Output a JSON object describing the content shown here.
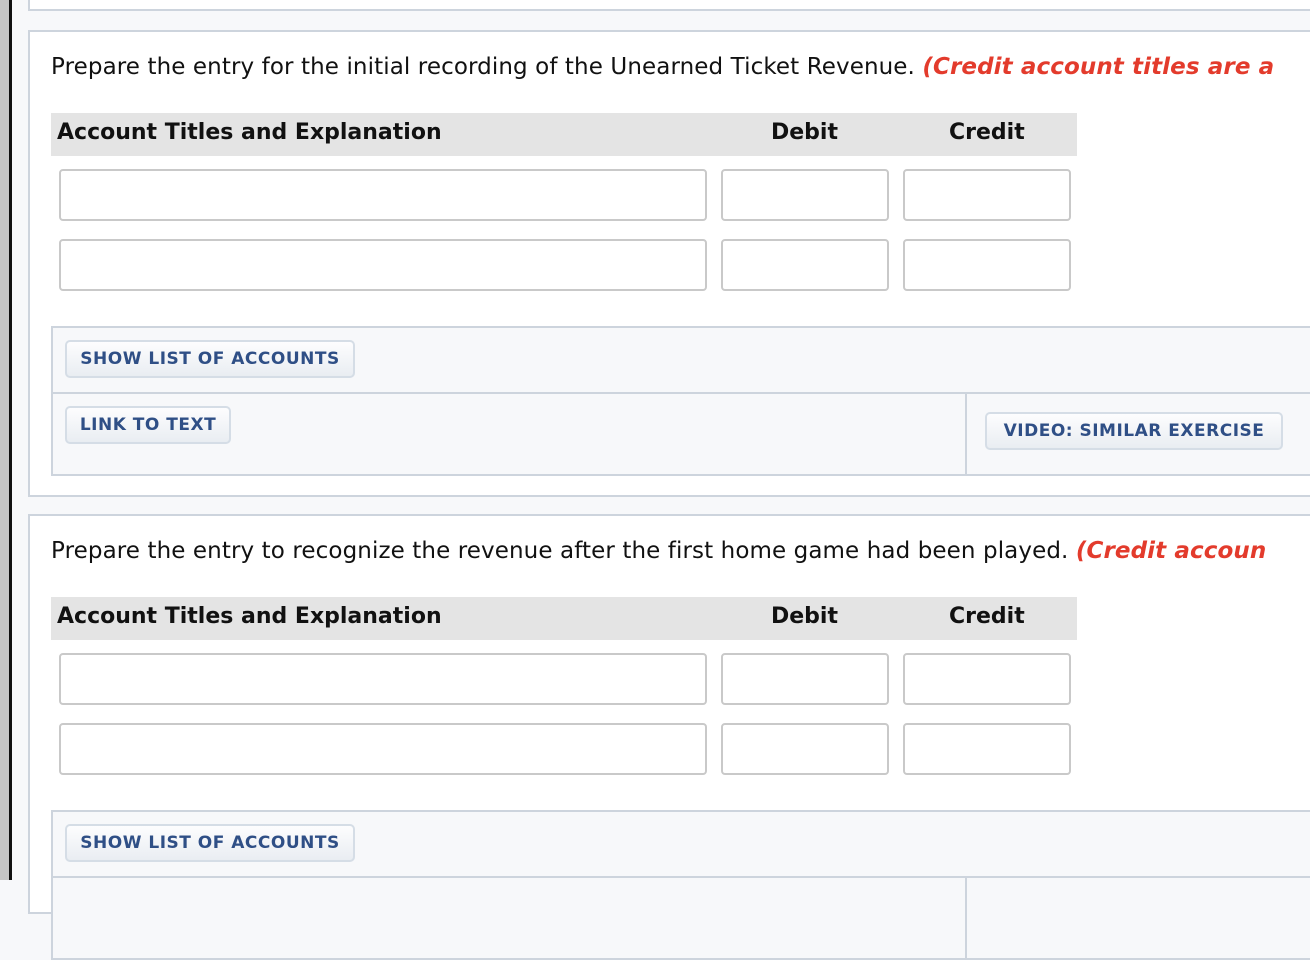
{
  "parts": [
    {
      "prompt": "Prepare the entry for the initial recording of the Unearned Ticket Revenue.",
      "note": "(Credit account titles are a",
      "headers": {
        "account": "Account Titles and Explanation",
        "debit": "Debit",
        "credit": "Credit"
      },
      "rows": [
        {
          "account": "",
          "debit": "",
          "credit": ""
        },
        {
          "account": "",
          "debit": "",
          "credit": ""
        }
      ],
      "buttons": {
        "show_accounts": "SHOW LIST OF ACCOUNTS",
        "link_to_text": "LINK TO TEXT",
        "video": "VIDEO: SIMILAR EXERCISE"
      }
    },
    {
      "prompt": "Prepare the entry to recognize the revenue after the first home game had been played.",
      "note": "(Credit accoun",
      "headers": {
        "account": "Account Titles and Explanation",
        "debit": "Debit",
        "credit": "Credit"
      },
      "rows": [
        {
          "account": "",
          "debit": "",
          "credit": ""
        },
        {
          "account": "",
          "debit": "",
          "credit": ""
        }
      ],
      "buttons": {
        "show_accounts": "SHOW LIST OF ACCOUNTS"
      }
    }
  ],
  "colors": {
    "note_red": "#e33b2c",
    "button_text": "#2f4f86",
    "header_bg": "#e4e4e4",
    "panel_border": "#cdd4dd"
  }
}
